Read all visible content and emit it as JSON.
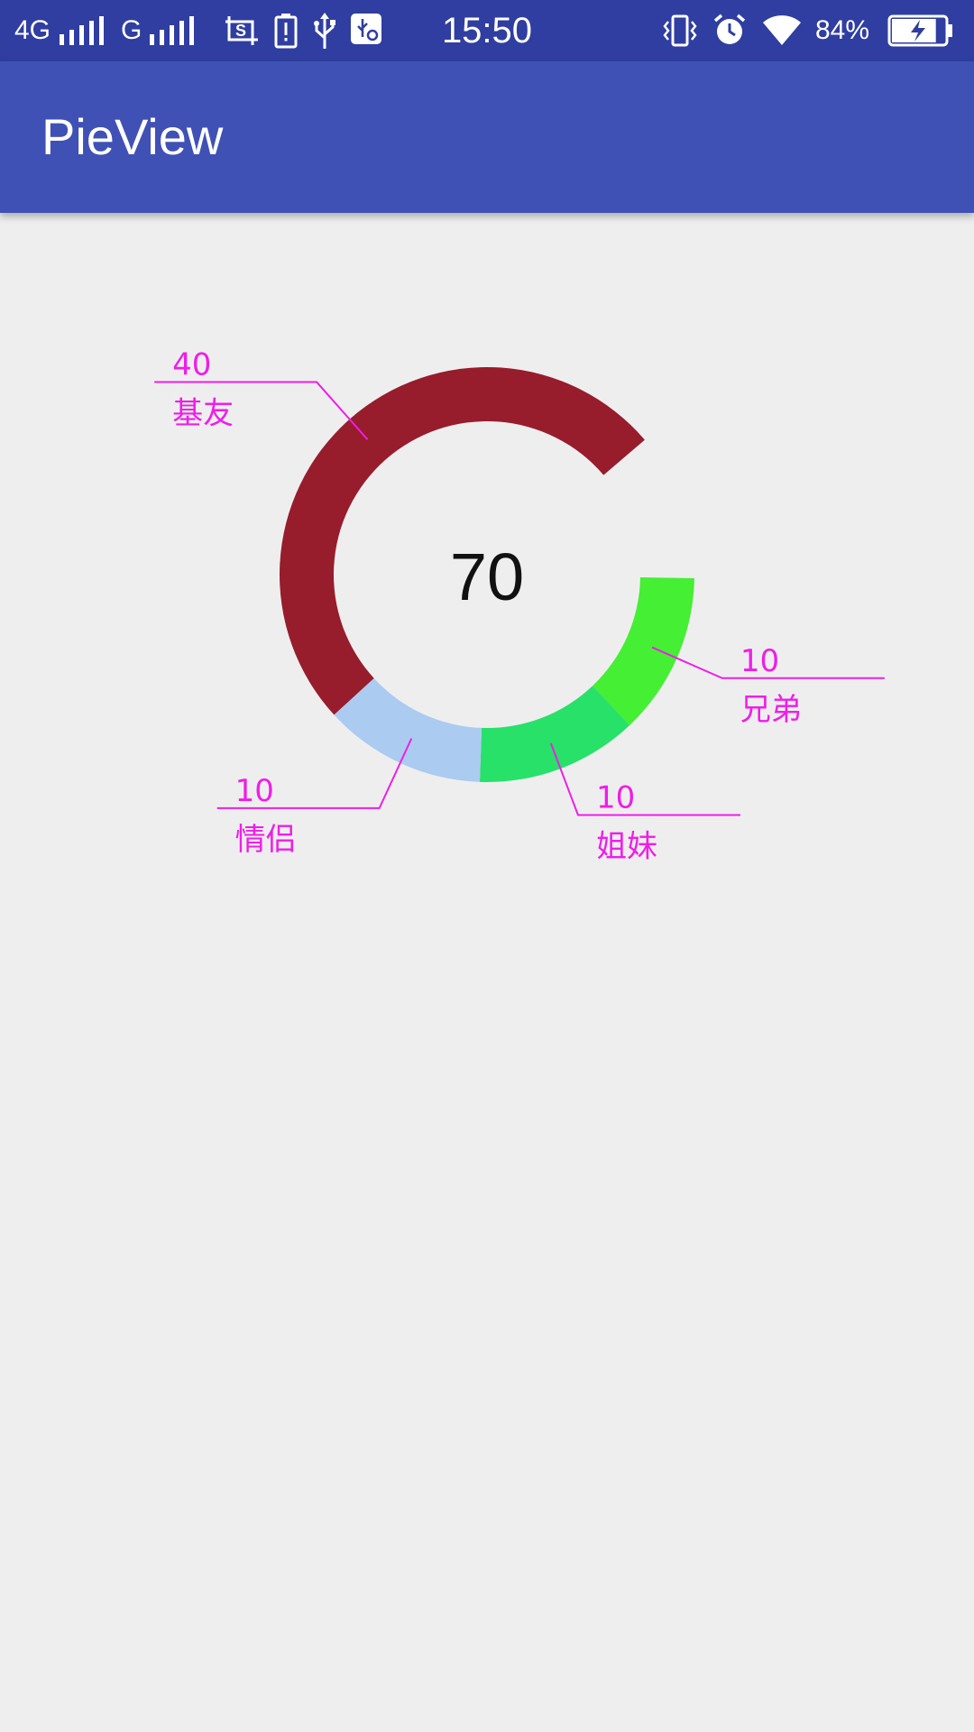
{
  "status_bar": {
    "network_1": "4G",
    "network_2": "G",
    "time": "15:50",
    "battery_percent": "84%",
    "battery_level": 0.84,
    "icons": [
      "signal-icon",
      "signal-icon",
      "screenshot-icon",
      "battery-alert-icon",
      "usb-icon",
      "usb-debug-icon",
      "vibrate-icon",
      "alarm-icon",
      "wifi-icon",
      "battery-charging-icon"
    ]
  },
  "app_bar": {
    "title": "PieView"
  },
  "colors": {
    "status_bar": "#2f3ea0",
    "app_bar": "#3f51b5",
    "background": "#efeeef",
    "label": "#ee1ee8"
  },
  "chart_data": {
    "type": "pie",
    "center_text": "70",
    "slices": [
      {
        "name": "兄弟",
        "value": 10,
        "value_label": "10",
        "color": "#45ef33"
      },
      {
        "name": "姐妹",
        "value": 10,
        "value_label": "10",
        "color": "#27e169"
      },
      {
        "name": "情侣",
        "value": 10,
        "value_label": "10",
        "color": "#abcbf0"
      },
      {
        "name": "基友",
        "value": 40,
        "value_label": "40",
        "color": "#971c2c"
      }
    ]
  }
}
